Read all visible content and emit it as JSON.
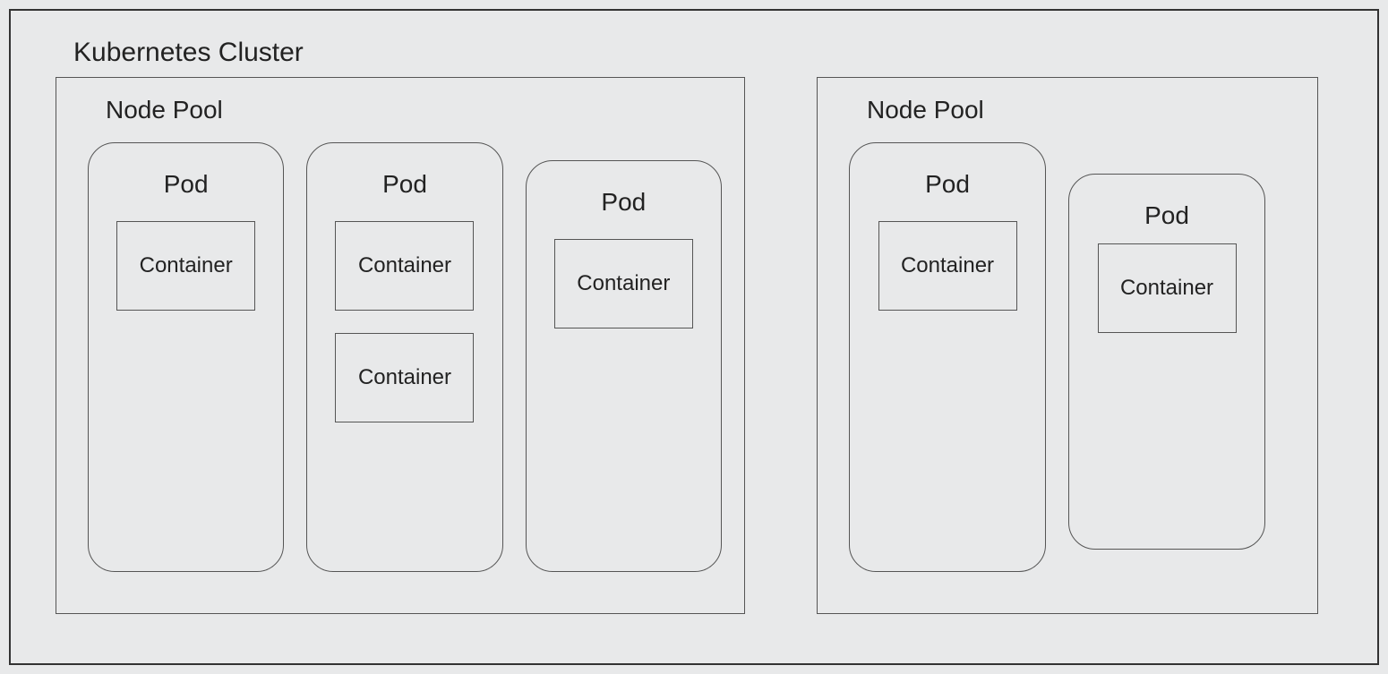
{
  "cluster": {
    "title": "Kubernetes Cluster",
    "nodePools": [
      {
        "title": "Node Pool",
        "pods": [
          {
            "title": "Pod",
            "containers": [
              "Container"
            ]
          },
          {
            "title": "Pod",
            "containers": [
              "Container",
              "Container"
            ]
          },
          {
            "title": "Pod",
            "containers": [
              "Container"
            ]
          }
        ]
      },
      {
        "title": "Node Pool",
        "pods": [
          {
            "title": "Pod",
            "containers": [
              "Container"
            ]
          },
          {
            "title": "Pod",
            "containers": [
              "Container"
            ]
          }
        ]
      }
    ]
  }
}
